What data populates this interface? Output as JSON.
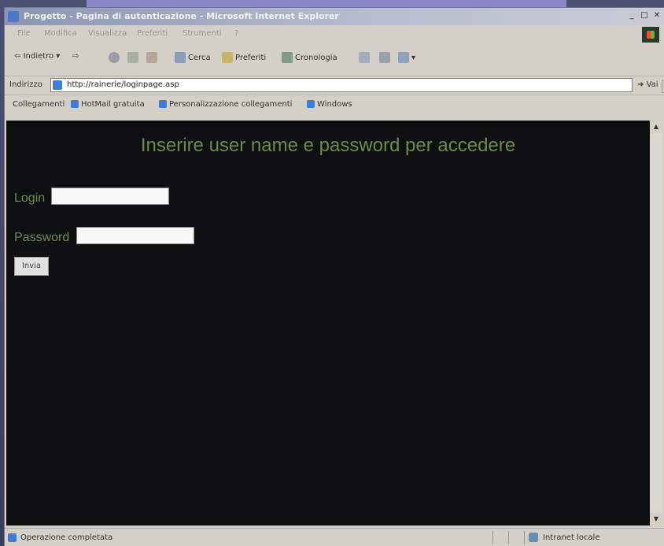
{
  "window": {
    "title": "Progetto - Pagina di autenticazione - Microsoft Internet Explorer",
    "min_label": "_",
    "max_label": "□",
    "close_label": "✕"
  },
  "menu": [
    "File",
    "Modifica",
    "Visualizza",
    "Preferiti",
    "Strumenti",
    "?"
  ],
  "toolbar": {
    "back_label": "Indietro",
    "search_label": "Cerca",
    "favorites_label": "Preferiti",
    "history_label": "Cronologia"
  },
  "address": {
    "label": "Indirizzo",
    "url": "http://rainerie/loginpage.asp",
    "go_label": "Vai"
  },
  "links": {
    "label": "Collegamenti",
    "items": [
      "HotMail gratuita",
      "Personalizzazione collegamenti",
      "Windows"
    ]
  },
  "page": {
    "heading": "Inserire user name e password per accedere",
    "login_label": "Login",
    "login_value": "",
    "password_label": "Password",
    "password_value": "",
    "submit_label": "Invia"
  },
  "status": {
    "text": "Operazione completata",
    "zone": "Intranet locale"
  },
  "colors": {
    "page_background": "#0d0f10",
    "text_green": "#6b8c46",
    "chrome": "#d4d0c8"
  }
}
